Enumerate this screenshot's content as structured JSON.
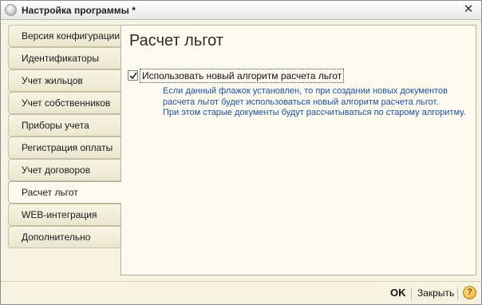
{
  "window": {
    "title": "Настройка программы *",
    "icons": {
      "app": "app-logo-icon",
      "close": "close-icon"
    }
  },
  "tabs": [
    {
      "label": "Версия конфигурации",
      "active": false
    },
    {
      "label": "Идентификаторы",
      "active": false
    },
    {
      "label": "Учет жильцов",
      "active": false
    },
    {
      "label": "Учет собственников",
      "active": false
    },
    {
      "label": "Приборы учета",
      "active": false
    },
    {
      "label": "Регистрация оплаты",
      "active": false
    },
    {
      "label": "Учет договоров",
      "active": false
    },
    {
      "label": "Расчет льгот",
      "active": true
    },
    {
      "label": "WEB-интеграция",
      "active": false
    },
    {
      "label": "Дополнительно",
      "active": false
    }
  ],
  "panel": {
    "title": "Расчет льгот",
    "checkbox_label": "Использовать новый алгоритм расчета льгот",
    "checkbox_checked": true,
    "hint_lines": [
      "Если данный флажок установлен, то при создании новых документов",
      "расчета льгот будет использоваться новый алгоритм расчета льгот.",
      "При этом старые документы будут рассчитываться по старому алгоритму."
    ]
  },
  "footer": {
    "ok_label": "OK",
    "close_label": "Закрыть",
    "help_label": "?"
  },
  "colors": {
    "hint_text": "#1d4fa8",
    "panel_bg": "#fdfbf0",
    "window_bg": "#f6f3e3"
  }
}
